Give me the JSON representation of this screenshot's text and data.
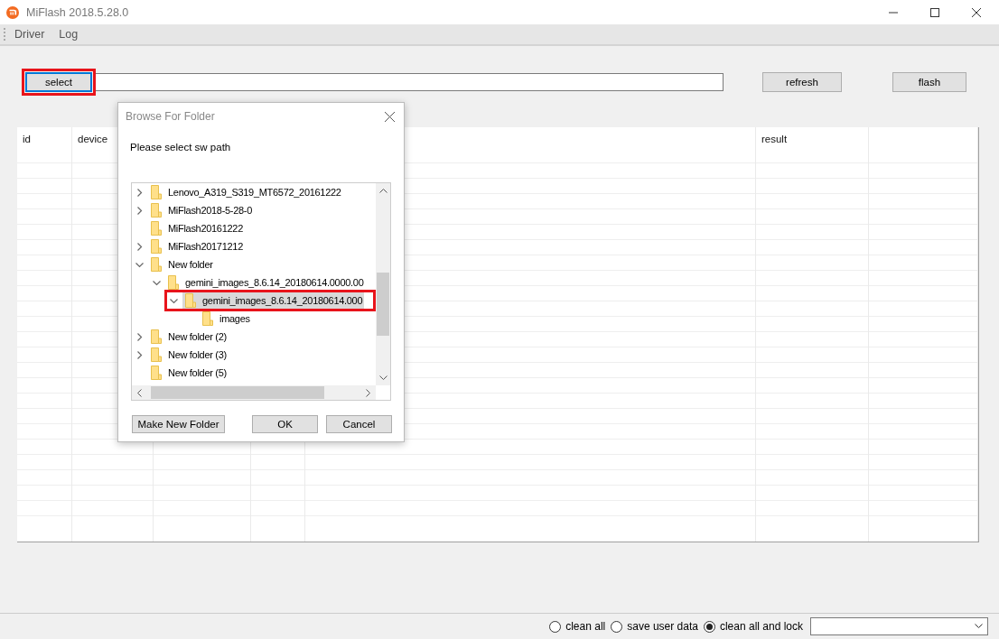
{
  "window": {
    "title": "MiFlash 2018.5.28.0"
  },
  "menu": [
    "Driver",
    "Log"
  ],
  "toolbar": {
    "select_button": "select",
    "refresh_button": "refresh",
    "flash_button": "flash"
  },
  "table": {
    "columns": [
      {
        "heading": "id"
      },
      {
        "heading": "device"
      },
      {},
      {},
      {},
      {
        "heading": "result"
      },
      {}
    ]
  },
  "dialog": {
    "title": "Browse For Folder",
    "prompt": "Please select sw path",
    "tree": [
      {
        "label": "Lenovo_A319_S319_MT6572_20161222",
        "expanded": false,
        "selected": false
      },
      {
        "label": "MiFlash2018-5-28-0",
        "expanded": false,
        "selected": false
      },
      {
        "label": "MiFlash20161222",
        "selected": false
      },
      {
        "label": "MiFlash20171212",
        "expanded": false,
        "selected": false
      },
      {
        "label": "New folder",
        "expanded": true,
        "selected": false,
        "children": [
          {
            "label": "gemini_images_8.6.14_20180614.0000.00",
            "expanded": true,
            "selected": false,
            "children": [
              {
                "label": "gemini_images_8.6.14_20180614.000",
                "expanded": true,
                "selected": true,
                "children": [
                  {
                    "label": "images",
                    "selected": false
                  }
                ]
              }
            ]
          }
        ]
      },
      {
        "label": "New folder (2)",
        "expanded": false,
        "selected": false
      },
      {
        "label": "New folder (3)",
        "expanded": false,
        "selected": false
      },
      {
        "label": "New folder (5)",
        "selected": false
      }
    ],
    "buttons": [
      "Make New Folder",
      "OK",
      "Cancel"
    ]
  },
  "options": [
    {
      "label": "clean all",
      "selected": false
    },
    {
      "label": "save user data",
      "selected": false
    },
    {
      "label": "clean all and lock",
      "selected": true
    }
  ]
}
